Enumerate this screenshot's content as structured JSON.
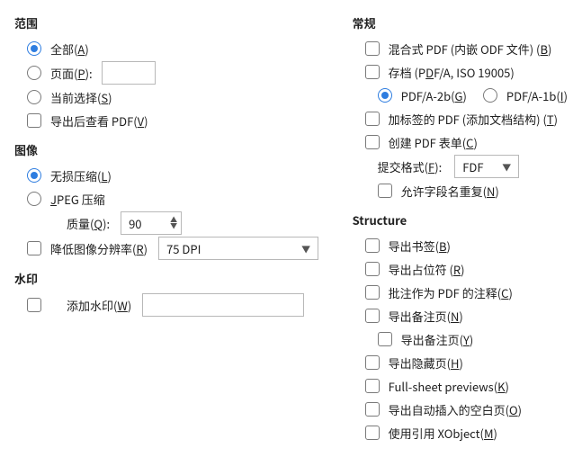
{
  "left": {
    "range": {
      "title": "范围",
      "all_pre": "全部(",
      "all_u": "A",
      "all_post": ")",
      "pages_pre": "页面(",
      "pages_u": "P",
      "pages_post": "):",
      "selection_pre": "当前选择(",
      "selection_u": "S",
      "selection_post": ")",
      "view_after_pre": "导出后查看 PDF(",
      "view_after_u": "V",
      "view_after_post": ")"
    },
    "image": {
      "title": "图像",
      "lossless_pre": "无损压缩(",
      "lossless_u": "L",
      "lossless_post": ")",
      "jpeg_pre": "",
      "jpeg_u": "J",
      "jpeg_post": "PEG 压缩",
      "quality_pre": "质量(",
      "quality_u": "Q",
      "quality_post": "):",
      "quality_value": "90",
      "reduce_pre": "降低图像分辨率(",
      "reduce_u": "R",
      "reduce_post": ")",
      "dpi_value": "75 DPI"
    },
    "watermark": {
      "title": "水印",
      "add_pre": "添加水印(",
      "add_u": "W",
      "add_post": ")"
    }
  },
  "right": {
    "general": {
      "title": "常规",
      "hybrid_pre": "混合式 PDF (内嵌 ODF 文件) (",
      "hybrid_u": "B",
      "hybrid_post": ")",
      "archive_pre": "存档 (P",
      "archive_u": "D",
      "archive_post": "F/A, ISO 19005)",
      "pdfa2b_pre": "PDF/A-2b(",
      "pdfa2b_u": "G",
      "pdfa2b_post": ")",
      "pdfa1b_pre": "PDF/A-1b(",
      "pdfa1b_u": "I",
      "pdfa1b_post": ")",
      "tagged_pre": "加标签的 PDF (添加文档结构) (",
      "tagged_u": "T",
      "tagged_post": ")",
      "form_pre": "创建 PDF 表单(",
      "form_u": "C",
      "form_post": ")",
      "submit_pre": "提交格式(",
      "submit_u": "F",
      "submit_post": "):",
      "submit_value": "FDF",
      "dup_pre": "允许字段名重复(",
      "dup_u": "N",
      "dup_post": ")"
    },
    "structure": {
      "title": "Structure",
      "bookmarks_pre": "导出书签(",
      "bookmarks_u": "B",
      "bookmarks_post": ")",
      "placeholders_pre": "导出占位符 (",
      "placeholders_u": "R",
      "placeholders_post": ")",
      "comments_pre": "批注作为 PDF 的注释(",
      "comments_u": "C",
      "comments_post": ")",
      "notes_pre": "导出备注页(",
      "notes_u": "N",
      "notes_post": ")",
      "only_notes_pre": "导出备注页(",
      "only_notes_u": "Y",
      "only_notes_post": ")",
      "hidden_pre": "导出隐藏页(",
      "hidden_u": "H",
      "hidden_post": ")",
      "fullsheet_pre": "Full-sheet previews(",
      "fullsheet_u": "K",
      "fullsheet_post": ")",
      "autoblank_pre": "导出自动插入的空白页(",
      "autoblank_u": "O",
      "autoblank_post": ")",
      "xobject_pre": "使用引用 XObject(",
      "xobject_u": "M",
      "xobject_post": ")"
    }
  }
}
